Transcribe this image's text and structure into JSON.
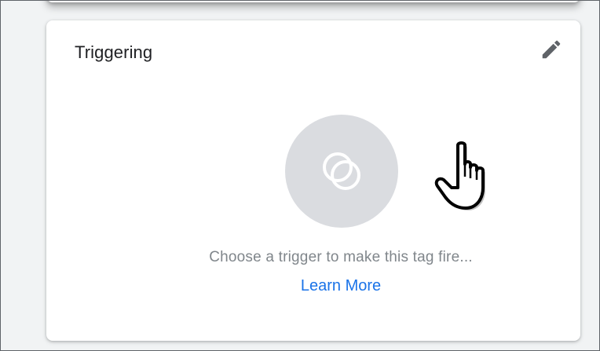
{
  "triggering_card": {
    "title": "Triggering",
    "edit_icon": "pencil-icon",
    "trigger_icon": "overlapping-circles-icon",
    "empty_message": "Choose a trigger to make this tag fire...",
    "learn_more_label": "Learn More"
  },
  "cursor": {
    "icon": "hand-pointer-cursor"
  },
  "colors": {
    "background": "#f1f3f4",
    "card": "#ffffff",
    "title_text": "#202124",
    "icon_gray": "#5f6368",
    "circle_fill": "#dadce0",
    "message_text": "#80868b",
    "link": "#1a73e8"
  }
}
